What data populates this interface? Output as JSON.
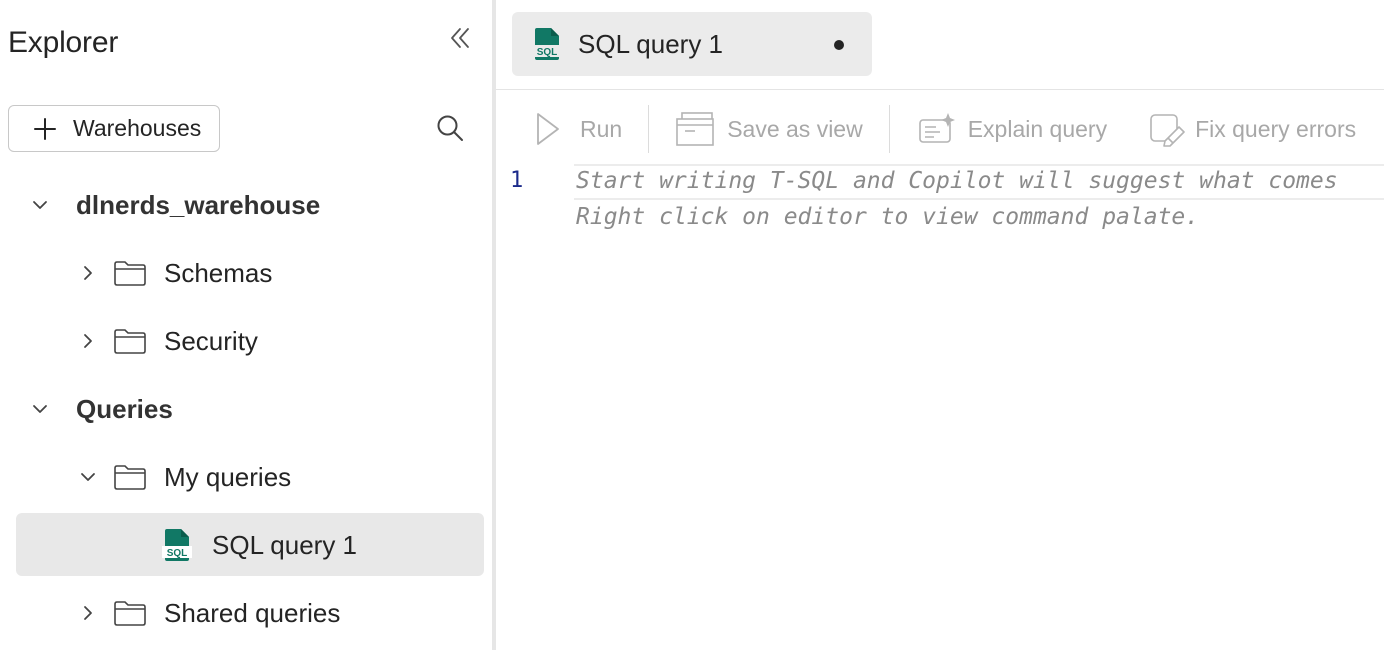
{
  "explorer": {
    "title": "Explorer",
    "add_button_label": "Warehouses",
    "tree": {
      "warehouse": {
        "label": "dlnerds_warehouse"
      },
      "schemas": {
        "label": "Schemas"
      },
      "security": {
        "label": "Security"
      },
      "queries": {
        "label": "Queries"
      },
      "my_queries": {
        "label": "My queries"
      },
      "sql_query_1": {
        "label": "SQL query 1"
      },
      "shared_queries": {
        "label": "Shared queries"
      }
    }
  },
  "editor": {
    "tab": {
      "label": "SQL query 1",
      "unsaved": true,
      "icon_text": "SQL"
    },
    "toolbar": {
      "run": "Run",
      "save_as_view": "Save as view",
      "explain_query": "Explain query",
      "fix_query_errors": "Fix query errors"
    },
    "line_number": "1",
    "hint_line_1": "Start writing T-SQL and Copilot will suggest what comes",
    "hint_line_2": "Right click on editor to view command palate."
  },
  "colors": {
    "sql_icon": "#117865",
    "selected_row_bg": "#e8e8e8",
    "disabled_text": "#a8a8a8",
    "line_number": "#1b2a8a"
  }
}
